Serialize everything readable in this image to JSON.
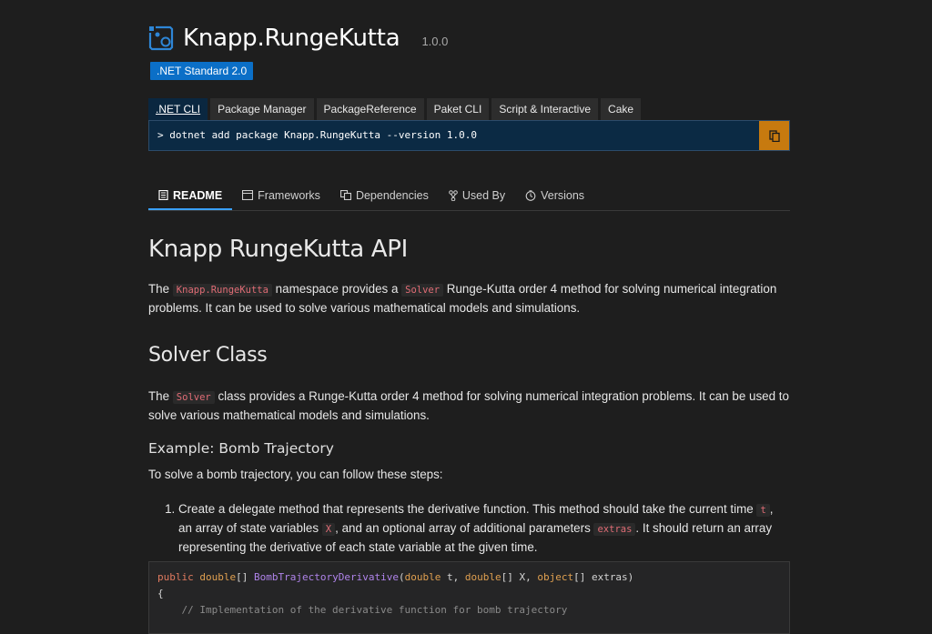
{
  "package": {
    "name": "Knapp.RungeKutta",
    "version": "1.0.0",
    "framework_badge": ".NET Standard 2.0"
  },
  "install": {
    "tabs": [
      ".NET CLI",
      "Package Manager",
      "PackageReference",
      "Paket CLI",
      "Script & Interactive",
      "Cake"
    ],
    "active_tab": 0,
    "command": "> dotnet add package Knapp.RungeKutta --version 1.0.0"
  },
  "doc_tabs": [
    {
      "label": "README",
      "icon": "readme-icon"
    },
    {
      "label": "Frameworks",
      "icon": "frameworks-icon"
    },
    {
      "label": "Dependencies",
      "icon": "dependencies-icon"
    },
    {
      "label": "Used By",
      "icon": "used-by-icon"
    },
    {
      "label": "Versions",
      "icon": "versions-icon"
    }
  ],
  "readme": {
    "h1": "Knapp RungeKutta API",
    "p1": {
      "t1": "The ",
      "c1": "Knapp.RungeKutta",
      "t2": " namespace provides a ",
      "c2": "Solver",
      "t3": " Runge-Kutta order 4 method for solving numerical integration problems. It can be used to solve various mathematical models and simulations."
    },
    "h2": "Solver Class",
    "p2": {
      "t1": "The ",
      "c1": "Solver",
      "t2": " class provides a Runge-Kutta order 4 method for solving numerical integration problems. It can be used to solve various mathematical models and simulations."
    },
    "h3": "Example: Bomb Trajectory",
    "p3": "To solve a bomb trajectory, you can follow these steps:",
    "step1": {
      "t1": "Create a delegate method that represents the derivative function. This method should take the current time ",
      "c1": "t",
      "t2": ", an array of state variables ",
      "c2": "X",
      "t3": ", and an optional array of additional parameters ",
      "c3": "extras",
      "t4": ". It should return an array representing the derivative of each state variable at the given time."
    },
    "code": {
      "kw_public": "public",
      "ty_double": "double",
      "brackets": "[] ",
      "fn_name": "BombTrajectoryDerivative",
      "params_open": "(",
      "p_double1": "double",
      "p_t": " t, ",
      "p_double2": "double",
      "p_X": "[] X, ",
      "p_object": "object",
      "p_extras": "[] extras)",
      "brace": "{",
      "comment": "    // Implementation of the derivative function for bomb trajectory"
    }
  }
}
